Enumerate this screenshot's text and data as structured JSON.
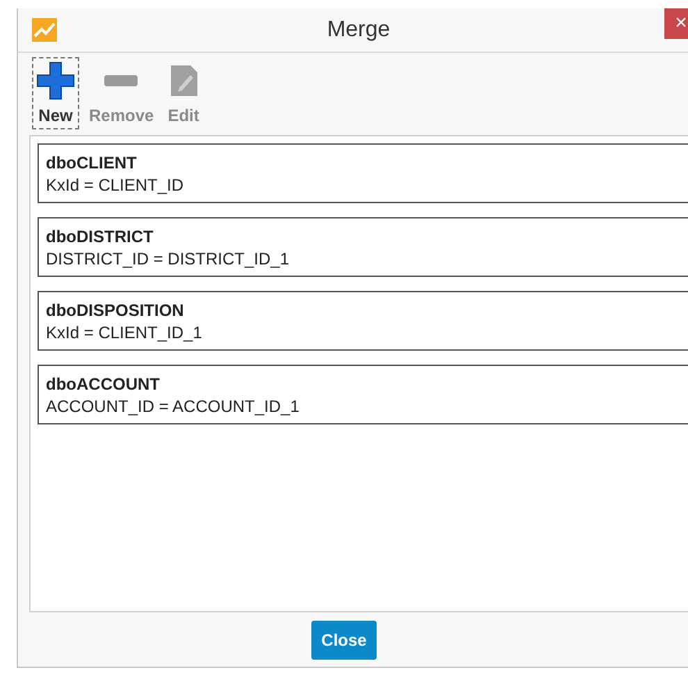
{
  "window": {
    "title": "Merge",
    "close": "×"
  },
  "toolbar": [
    {
      "kind": "new",
      "label": "New",
      "disabled": false,
      "focused": true
    },
    {
      "kind": "remove",
      "label": "Remove",
      "disabled": true,
      "focused": false
    },
    {
      "kind": "edit",
      "label": "Edit",
      "disabled": true,
      "focused": false
    }
  ],
  "joins": [
    {
      "table": "dboCLIENT",
      "condition": "KxId = CLIENT_ID"
    },
    {
      "table": "dboDISTRICT",
      "condition": "DISTRICT_ID = DISTRICT_ID_1"
    },
    {
      "table": "dboDISPOSITION",
      "condition": "KxId = CLIENT_ID_1"
    },
    {
      "table": "dboACCOUNT",
      "condition": "ACCOUNT_ID = ACCOUNT_ID_1"
    }
  ],
  "buttons": [
    "Close"
  ]
}
